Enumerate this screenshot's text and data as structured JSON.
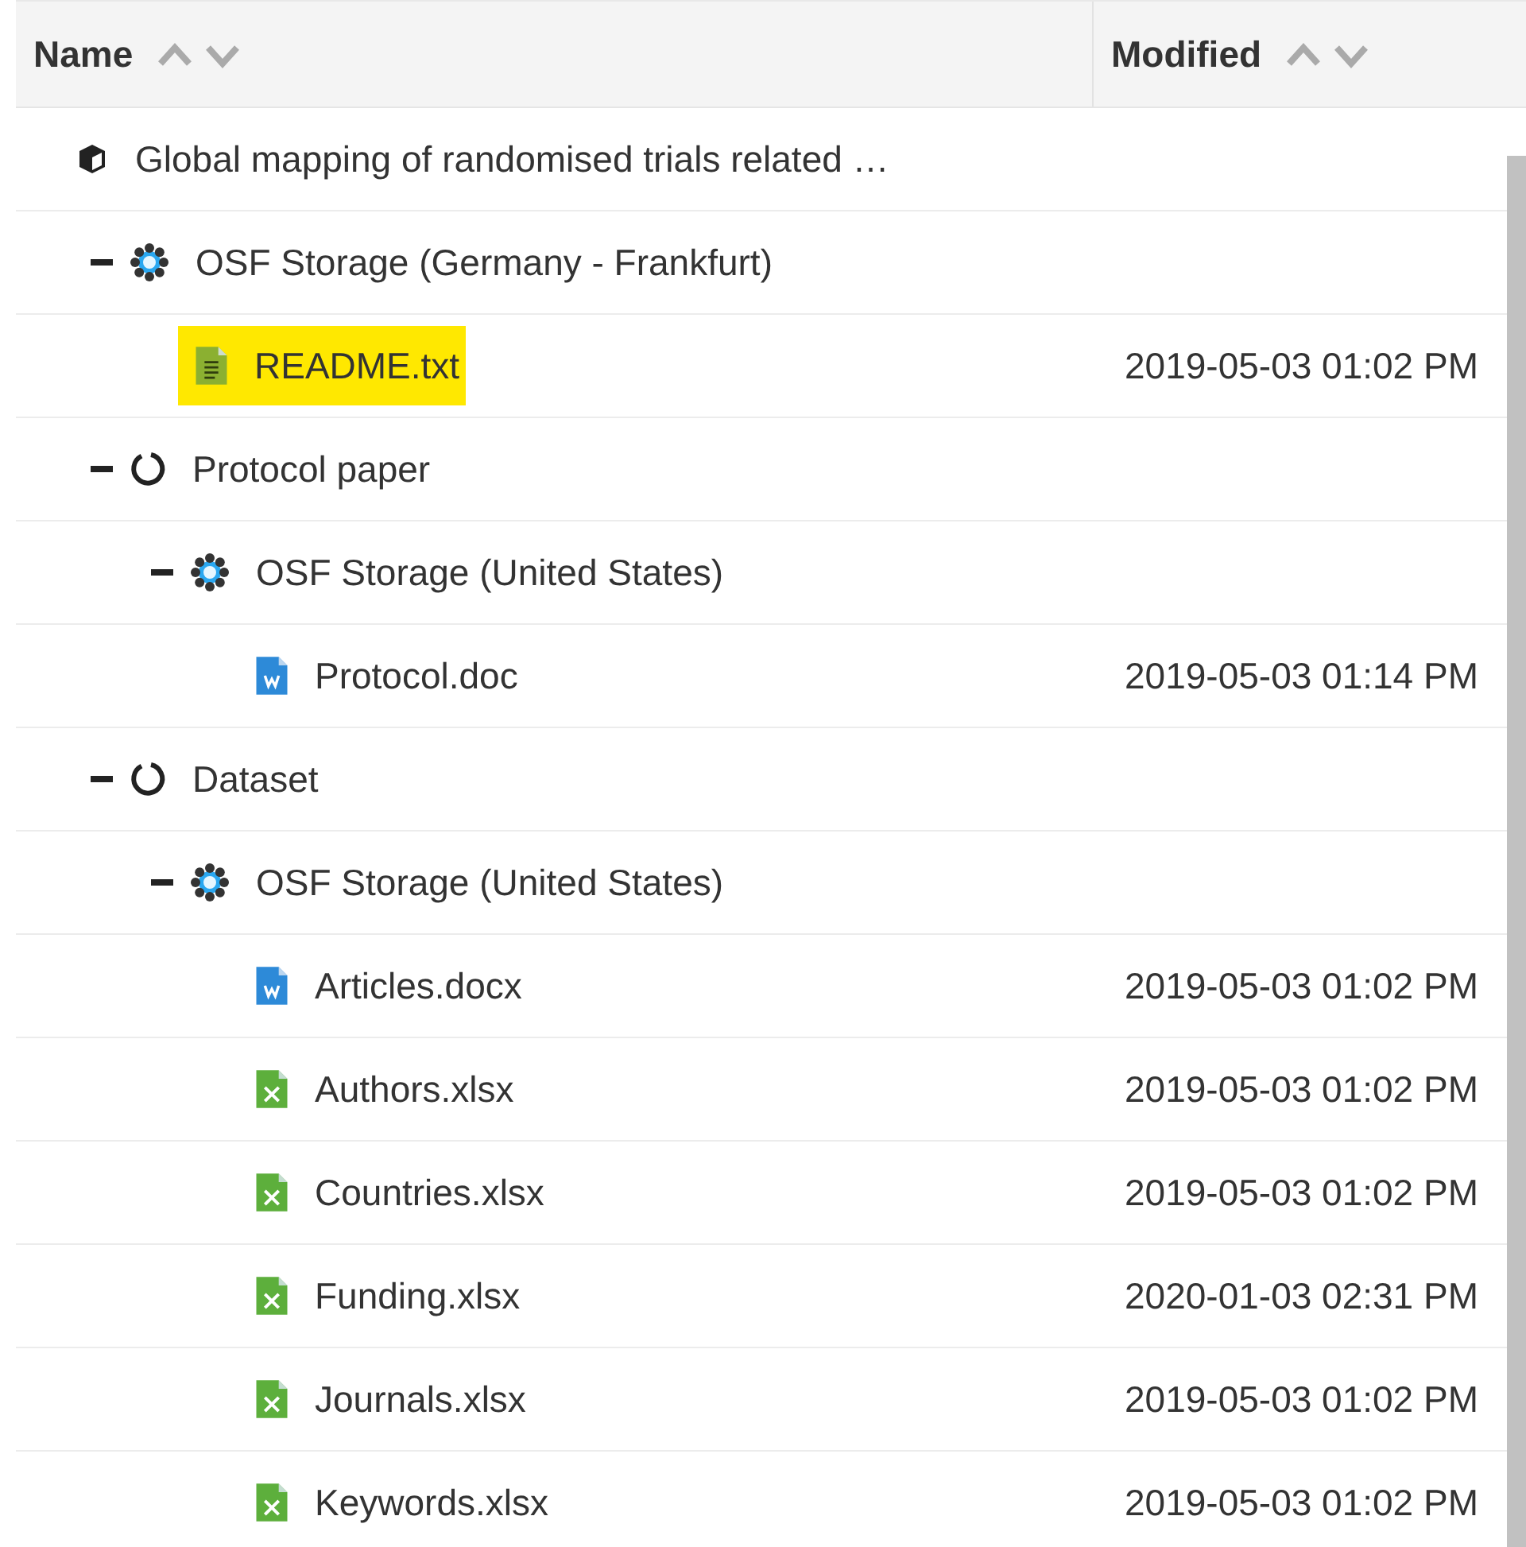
{
  "columns": [
    {
      "label": "Name"
    },
    {
      "label": "Modified"
    }
  ],
  "tree": [
    {
      "kind": "project",
      "name": "Global mapping of randomised trials related …",
      "children": [
        {
          "kind": "storage",
          "name": "OSF Storage (Germany - Frankfurt)",
          "expanded": true,
          "children": [
            {
              "kind": "text-file",
              "name": "README.txt",
              "modified": "2019-05-03 01:02 PM",
              "highlighted": true
            }
          ]
        },
        {
          "kind": "component",
          "name": "Protocol paper",
          "expanded": true,
          "children": [
            {
              "kind": "storage",
              "name": "OSF Storage (United States)",
              "expanded": true,
              "children": [
                {
                  "kind": "word-file",
                  "name": "Protocol.doc",
                  "modified": "2019-05-03 01:14 PM",
                  "highlighted": false
                }
              ]
            }
          ]
        },
        {
          "kind": "component",
          "name": "Dataset",
          "expanded": true,
          "children": [
            {
              "kind": "storage",
              "name": "OSF Storage (United States)",
              "expanded": true,
              "children": [
                {
                  "kind": "word-file",
                  "name": "Articles.docx",
                  "modified": "2019-05-03 01:02 PM",
                  "highlighted": false
                },
                {
                  "kind": "excel-file",
                  "name": "Authors.xlsx",
                  "modified": "2019-05-03 01:02 PM",
                  "highlighted": false
                },
                {
                  "kind": "excel-file",
                  "name": "Countries.xlsx",
                  "modified": "2019-05-03 01:02 PM",
                  "highlighted": false
                },
                {
                  "kind": "excel-file",
                  "name": "Funding.xlsx",
                  "modified": "2020-01-03 02:31 PM",
                  "highlighted": false
                },
                {
                  "kind": "excel-file",
                  "name": "Journals.xlsx",
                  "modified": "2019-05-03 01:02 PM",
                  "highlighted": false
                },
                {
                  "kind": "excel-file",
                  "name": "Keywords.xlsx",
                  "modified": "2019-05-03 01:02 PM",
                  "highlighted": false
                }
              ]
            }
          ]
        }
      ]
    }
  ]
}
